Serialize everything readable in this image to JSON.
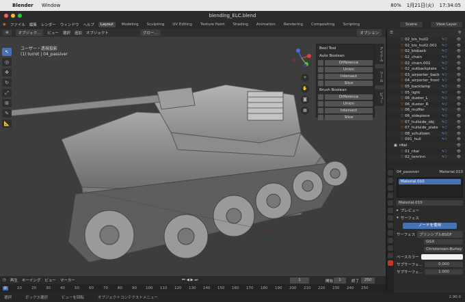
{
  "macos": {
    "app": "Blender",
    "menu": "Window",
    "battery": "80%",
    "date": "1月21日(火)",
    "time": "17:34:05"
  },
  "window": {
    "title": "blending_ELC.blend"
  },
  "topbar": {
    "menus": [
      "ファイル",
      "編集",
      "レンダー",
      "ウィンドウ",
      "ヘルプ"
    ],
    "workspaces": [
      "Layout",
      "Modeling",
      "Sculpting",
      "UV Editing",
      "Texture Paint",
      "Shading",
      "Animation",
      "Rendering",
      "Compositing",
      "Scripting"
    ],
    "active": "Layout",
    "scene": "Scene",
    "view_layer": "View Layer"
  },
  "header3d": {
    "mode": "オブジェク...",
    "menus": [
      "ビュー",
      "選択",
      "追加",
      "オブジェクト"
    ],
    "transform": "グロー...",
    "options": "オプション"
  },
  "viewport": {
    "view_label": "ユーザー・透視投影",
    "object_label": "(1) turret | 04_passiver"
  },
  "booltool": {
    "title": "Bool Tool",
    "auto_label": "Auto Boolean",
    "auto": [
      "Difference",
      "Union",
      "Intersect",
      "Slice"
    ],
    "brush_label": "Brush Boolean",
    "brush": [
      "Difference",
      "Union",
      "Intersect",
      "Slice"
    ]
  },
  "side_tabs": [
    "アイテム",
    "ツール",
    "ビュー"
  ],
  "outliner": {
    "rows": [
      {
        "label": "02_bis_hull2",
        "coll": false
      },
      {
        "label": "02_bis_hull2.001",
        "coll": false
      },
      {
        "label": "02_bisback",
        "coll": false
      },
      {
        "label": "02_chain",
        "coll": false
      },
      {
        "label": "02_chain.001",
        "coll": false
      },
      {
        "label": "02_outbackplate",
        "coll": false
      },
      {
        "label": "03_airporter_back",
        "coll": false
      },
      {
        "label": "04_airporter_front",
        "coll": false
      },
      {
        "label": "05_backlamp",
        "coll": false
      },
      {
        "label": "05_light",
        "coll": false
      },
      {
        "label": "06_duster_L",
        "coll": false
      },
      {
        "label": "06_duster_R",
        "coll": false
      },
      {
        "label": "06_muffer",
        "coll": false
      },
      {
        "label": "06_sidepiece",
        "coll": false
      },
      {
        "label": "07_hullside_obj",
        "coll": false
      },
      {
        "label": "07_hullside_plate",
        "coll": false
      },
      {
        "label": "08_schultzen",
        "coll": false
      },
      {
        "label": "091_hull",
        "coll": false
      },
      {
        "label": "ritai",
        "coll": true
      },
      {
        "label": "01_ritai",
        "coll": false
      },
      {
        "label": "02_tenrinn",
        "coll": false
      }
    ]
  },
  "props": {
    "object": "04_passiver",
    "material_header": "Material.010",
    "slot_item": "Material.010",
    "material_field": "Material.010",
    "preview": "プレビュー",
    "surface_header": "サーフェス",
    "use_nodes": "ノードを使用",
    "surface_label": "サーフェス",
    "surface_value": "プリンシプルBSDF",
    "dist1": "GGX",
    "dist2": "Christensen-Burley",
    "base_color": "ベースカラー",
    "subsurface": "サブサーフェ...",
    "subsurface_val": "0.000",
    "subsurface2": "サブサーフェ...",
    "subsurface2_val": "1.000"
  },
  "timeline": {
    "menus": [
      "再生",
      "キーイング",
      "ビュー",
      "マーカー"
    ],
    "current": "1",
    "start_label": "開始",
    "start": "1",
    "end_label": "終了",
    "end": "250"
  },
  "ruler": [
    "0",
    "10",
    "20",
    "30",
    "40",
    "50",
    "60",
    "70",
    "80",
    "90",
    "100",
    "110",
    "120",
    "130",
    "140",
    "150",
    "160",
    "170",
    "180",
    "190",
    "200",
    "210",
    "220",
    "230",
    "240",
    "250"
  ],
  "status": {
    "items": [
      "選択",
      "ボックス選択",
      "ビューを回転",
      "オブジェクトコンテクストメニュー"
    ],
    "version": "2.90.0"
  }
}
